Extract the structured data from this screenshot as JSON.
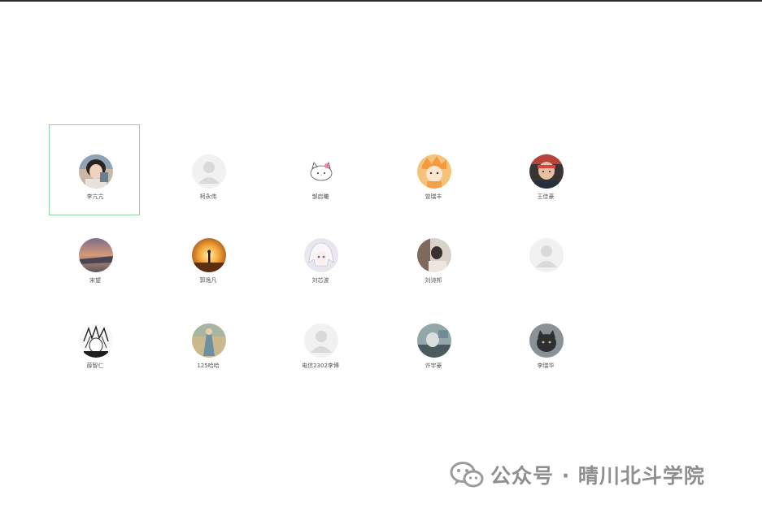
{
  "contacts": [
    {
      "name": "李亢亢",
      "selected": true,
      "avatar": "photo-girl"
    },
    {
      "name": "柯永伟",
      "selected": false,
      "avatar": "default"
    },
    {
      "name": "邹启曦",
      "selected": false,
      "avatar": "hello-kitty"
    },
    {
      "name": "曾瑞丰",
      "selected": false,
      "avatar": "cartoon-orange"
    },
    {
      "name": "王佳豪",
      "selected": false,
      "avatar": "photo-boy-red"
    },
    {
      "name": "宋望",
      "selected": false,
      "avatar": "sunset-sky"
    },
    {
      "name": "郭逸凡",
      "selected": false,
      "avatar": "sunset-figure"
    },
    {
      "name": "刘芯波",
      "selected": false,
      "avatar": "anime-white-hair"
    },
    {
      "name": "刘诗邦",
      "selected": false,
      "avatar": "photo-room"
    },
    {
      "name": "",
      "selected": false,
      "avatar": "default"
    },
    {
      "name": "薛智仁",
      "selected": false,
      "avatar": "manga-sketch"
    },
    {
      "name": "125哈哈",
      "selected": false,
      "avatar": "painting"
    },
    {
      "name": "电信2302李博",
      "selected": false,
      "avatar": "default"
    },
    {
      "name": "许宇豪",
      "selected": false,
      "avatar": "photo-blue"
    },
    {
      "name": "李瑞华",
      "selected": false,
      "avatar": "photo-cat"
    }
  ],
  "watermark": {
    "text": "公众号 · 晴川北斗学院",
    "logo_icon": "wechat-icon"
  }
}
